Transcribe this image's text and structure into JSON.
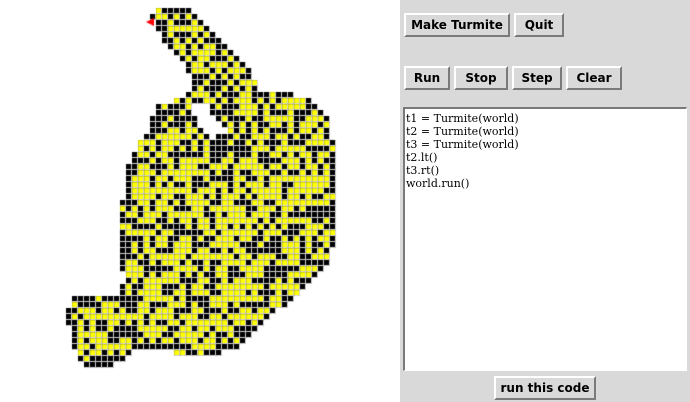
{
  "toolbar": {
    "make_turmite_label": "Make Turmite",
    "quit_label": "Quit"
  },
  "controls": {
    "run_label": "Run",
    "stop_label": "Stop",
    "step_label": "Step",
    "clear_label": "Clear"
  },
  "code": {
    "lines": [
      "t1 = Turmite(world)",
      "t2 = Turmite(world)",
      "t3 = Turmite(world)",
      "t2.lt()",
      "t3.rt()",
      "world.run()"
    ],
    "run_button_label": "run this code"
  },
  "world": {
    "colors": {
      "black_cell": "#000000",
      "yellow_cell": "#ffff00",
      "background": "#ffffff",
      "turmite": "#ff0000"
    },
    "turmite_heading": "west"
  }
}
